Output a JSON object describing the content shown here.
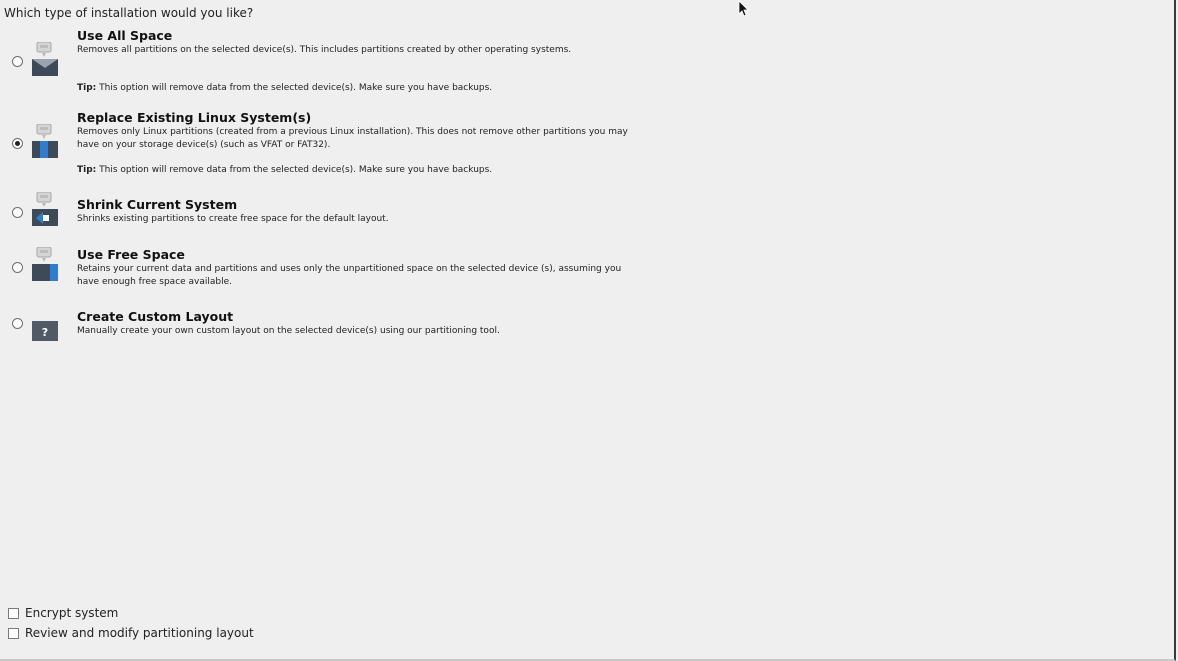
{
  "question": "Which type of installation would you like?",
  "options": [
    {
      "title": "Use All Space",
      "description": "Removes all partitions on the selected device(s).  This includes partitions created by other operating systems.",
      "tip_label": "Tip:",
      "tip_text": " This option will remove data from the selected device(s).  Make sure you have backups.",
      "icon": "hard-drive-icon",
      "selected": false
    },
    {
      "title": "Replace Existing Linux System(s)",
      "description": "Removes only Linux partitions (created from a previous Linux installation).  This does not remove other partitions you may have on your storage device(s) (such as VFAT or FAT32).",
      "tip_label": "Tip:",
      "tip_text": " This option will remove data from the selected device(s).  Make sure you have backups.",
      "icon": "hard-drive-replace-icon",
      "selected": true
    },
    {
      "title": "Shrink Current System",
      "description": "Shrinks existing partitions to create free space for the default layout.",
      "icon": "hard-drive-shrink-icon",
      "selected": false
    },
    {
      "title": "Use Free Space",
      "description": "Retains your current data and partitions and uses only the unpartitioned space on the selected device (s), assuming you have enough free space available.",
      "icon": "hard-drive-free-icon",
      "selected": false
    },
    {
      "title": "Create Custom Layout",
      "description": "Manually create your own custom layout on the selected device(s) using our partitioning tool.",
      "icon": "question-icon",
      "selected": false
    }
  ],
  "checkboxes": {
    "encrypt_label": "Encrypt system",
    "review_label": "Review and modify partitioning layout"
  },
  "colors": {
    "background": "#efefef",
    "drive_dark": "#3e4a57",
    "drive_accent": "#2f7dd1"
  }
}
